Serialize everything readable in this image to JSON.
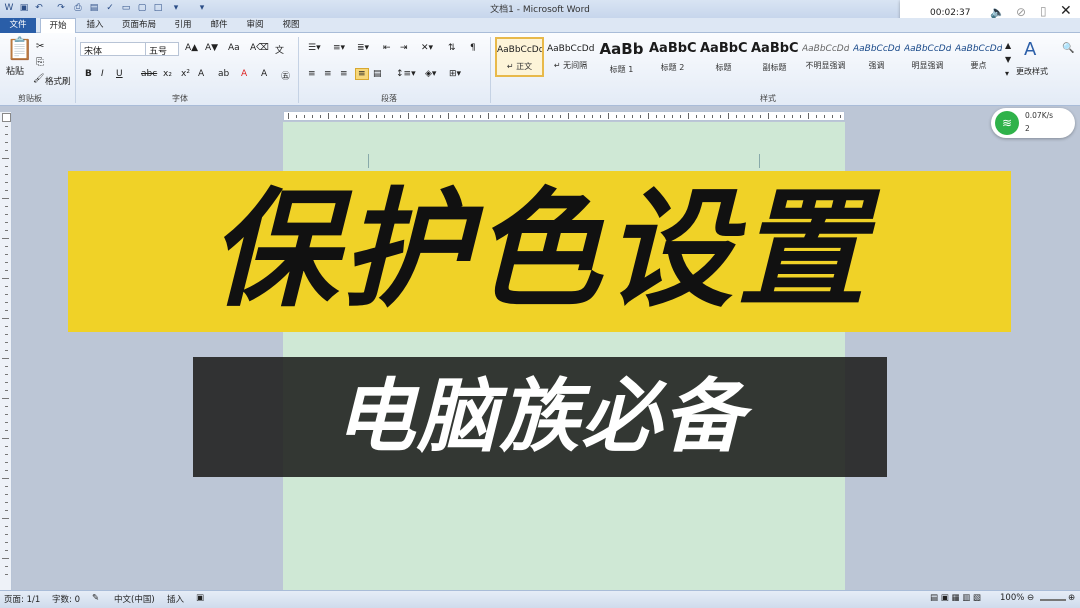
{
  "window": {
    "title": "文档1 - Microsoft Word"
  },
  "recording": {
    "time": "00:02:37"
  },
  "tabs": [
    "文件",
    "开始",
    "插入",
    "页面布局",
    "引用",
    "邮件",
    "审阅",
    "视图"
  ],
  "clipboard": {
    "paste": "粘贴",
    "format_painter": "格式刷",
    "group": "剪贴板"
  },
  "font": {
    "name": "宋体",
    "size": "五号",
    "group": "字体"
  },
  "paragraph": {
    "group": "段落"
  },
  "styles": {
    "group": "样式",
    "change_styles": "更改样式",
    "items": [
      {
        "sample": "AaBbCcDd",
        "name": "↵ 正文"
      },
      {
        "sample": "AaBbCcDd",
        "name": "↵ 无间隔"
      },
      {
        "sample": "AaBb",
        "name": "标题 1"
      },
      {
        "sample": "AaBbC",
        "name": "标题 2"
      },
      {
        "sample": "AaBbC",
        "name": "标题"
      },
      {
        "sample": "AaBbC",
        "name": "副标题"
      },
      {
        "sample": "AaBbCcDd",
        "name": "不明显强调"
      },
      {
        "sample": "AaBbCcDd",
        "name": "强调"
      },
      {
        "sample": "AaBbCcDd",
        "name": "明显强调"
      },
      {
        "sample": "AaBbCcDd",
        "name": "要点"
      }
    ]
  },
  "network": {
    "speed": "0.07K/s",
    "devices": "2"
  },
  "overlay": {
    "headline": "保护色设置",
    "subline": "电脑族必备"
  },
  "statusbar": {
    "page": "页面: 1/1",
    "words": "字数: 0",
    "language": "中文(中国)",
    "mode": "插入",
    "zoom": "100%"
  },
  "colors": {
    "headline_bg": "#f0d227",
    "subline_bg": "#1e1e1c",
    "page_bg": "#cfe8d5",
    "file_tab": "#2a5ea8"
  }
}
